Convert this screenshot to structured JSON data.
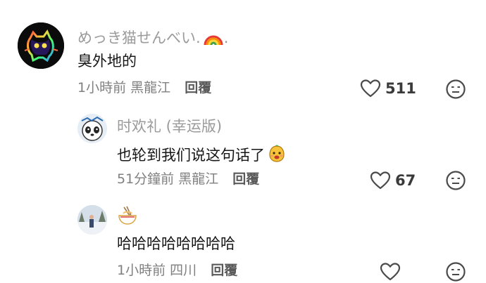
{
  "comments": [
    {
      "author": "めっき猫せんべい.",
      "author_suffix": ".",
      "author_emoji": "rainbow-icon",
      "text": "臭外地的",
      "time": "1小時前",
      "location": "黑龍江",
      "reply_label": "回覆",
      "likes": "511"
    },
    {
      "author": "时欢礼 (幸运版)",
      "text": "也轮到我们说这句话了",
      "text_emoji": "smiling-face-icon",
      "time": "51分鐘前",
      "location": "黑龍江",
      "reply_label": "回覆",
      "likes": "67"
    },
    {
      "author_emoji": "noodle-bowl-icon",
      "text": "哈哈哈哈哈哈哈哈",
      "time": "1小時前",
      "location": "四川",
      "reply_label": "回覆",
      "likes": ""
    }
  ],
  "colors": {
    "author": "#9a9a9a",
    "text": "#161616",
    "meta": "#808080",
    "reply": "#5a5a5a",
    "icon": "#4a4a4a"
  }
}
